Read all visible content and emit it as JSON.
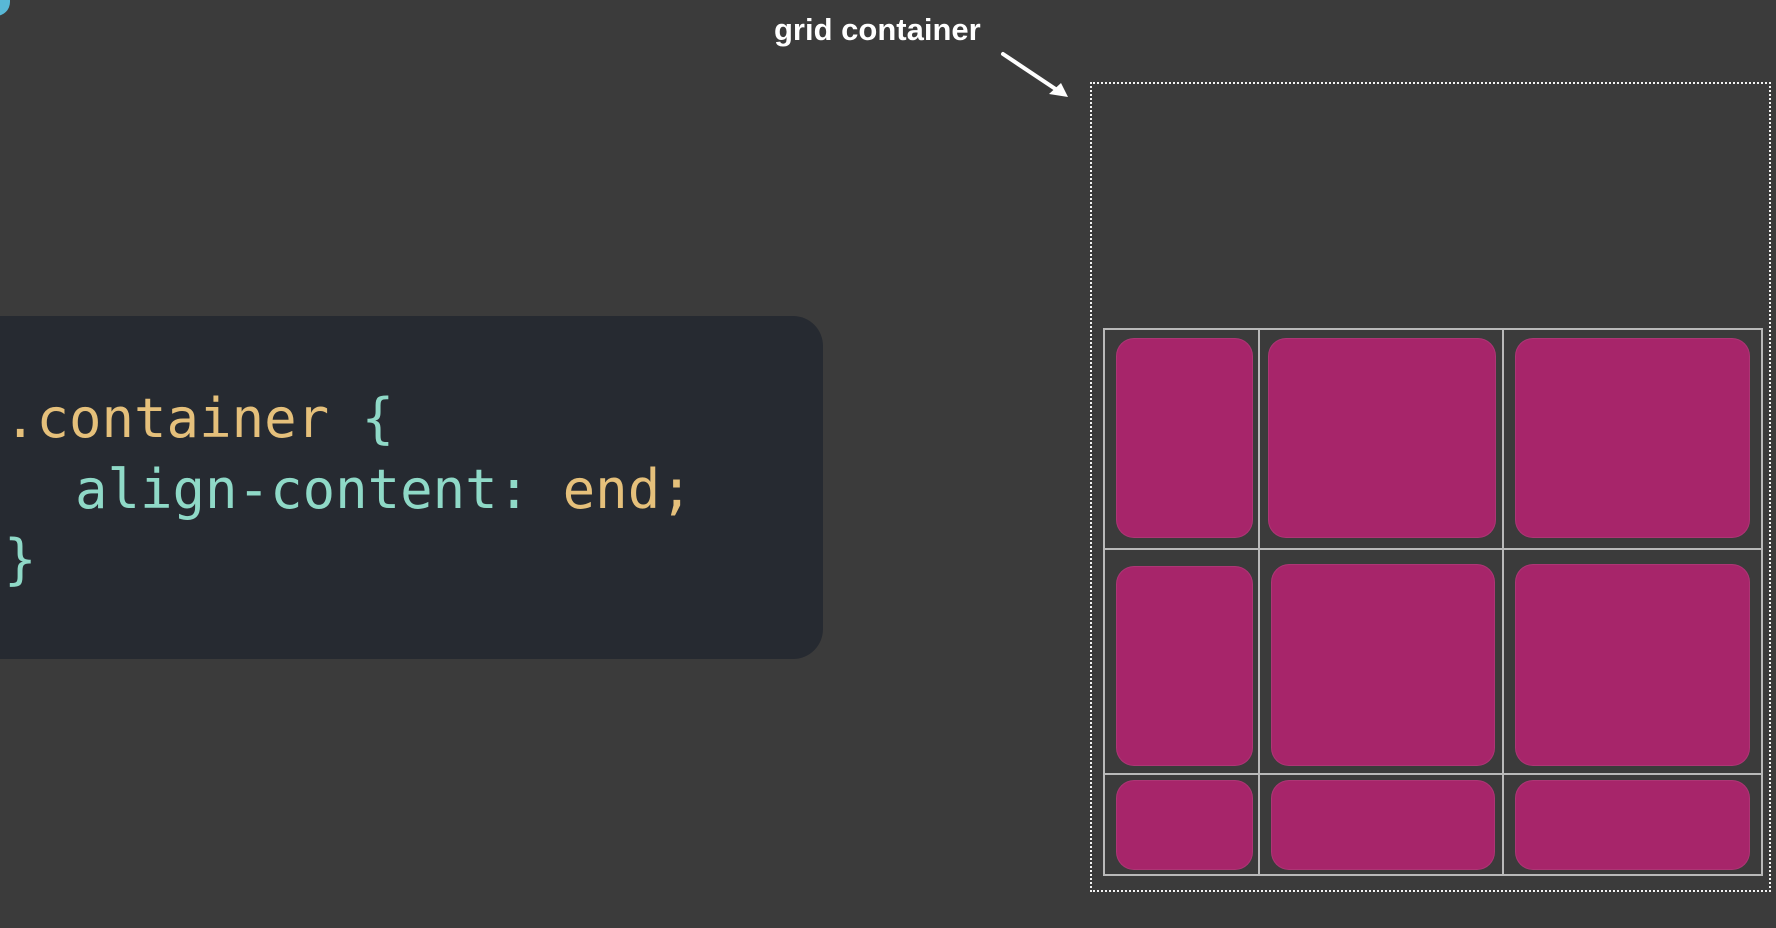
{
  "annotation": {
    "label": "grid container"
  },
  "code": {
    "selector": ".container",
    "open_brace": "{",
    "property": "align-content",
    "colon": ":",
    "value": "end",
    "semicolon": ";",
    "close_brace": "}"
  },
  "grid": {
    "columns": 3,
    "rows": 3,
    "item_count": 9,
    "align_content": "end"
  },
  "colors": {
    "background": "#3b3b3b",
    "code_panel": "#262a31",
    "selector_and_value": "#e5c07b",
    "property_and_braces": "#8fd9c7",
    "item_fill": "#a7256a",
    "grid_line": "#b9b9b9",
    "corner_shape": "#58b8d6"
  },
  "icons": {
    "annotation_arrow": "arrow-icon"
  }
}
